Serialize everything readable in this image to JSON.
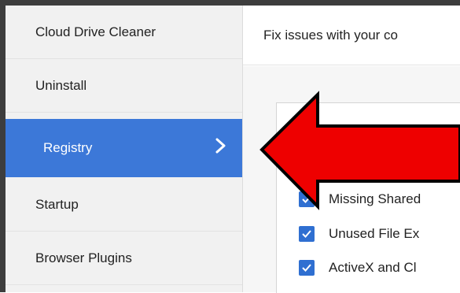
{
  "sidebar": {
    "items": [
      {
        "label": "Cloud Drive Cleaner"
      },
      {
        "label": "Uninstall"
      },
      {
        "label": "Registry",
        "active": true
      },
      {
        "label": "Startup"
      },
      {
        "label": "Browser Plugins"
      }
    ]
  },
  "header": {
    "text": "Fix issues with your co"
  },
  "registry_items": [
    {
      "label": "Missing Shared",
      "checked": true
    },
    {
      "label": "Unused File Ex",
      "checked": true
    },
    {
      "label": "ActiveX and Cl",
      "checked": true
    }
  ],
  "colors": {
    "accent": "#3c78d8",
    "checkbox": "#2f6fd1",
    "arrow_fill": "#ee0000",
    "arrow_stroke": "#000000"
  },
  "icons": {
    "active_item": "chevron-right-icon",
    "checkbox": "checkmark-icon",
    "annotation": "red-arrow-left-icon"
  }
}
